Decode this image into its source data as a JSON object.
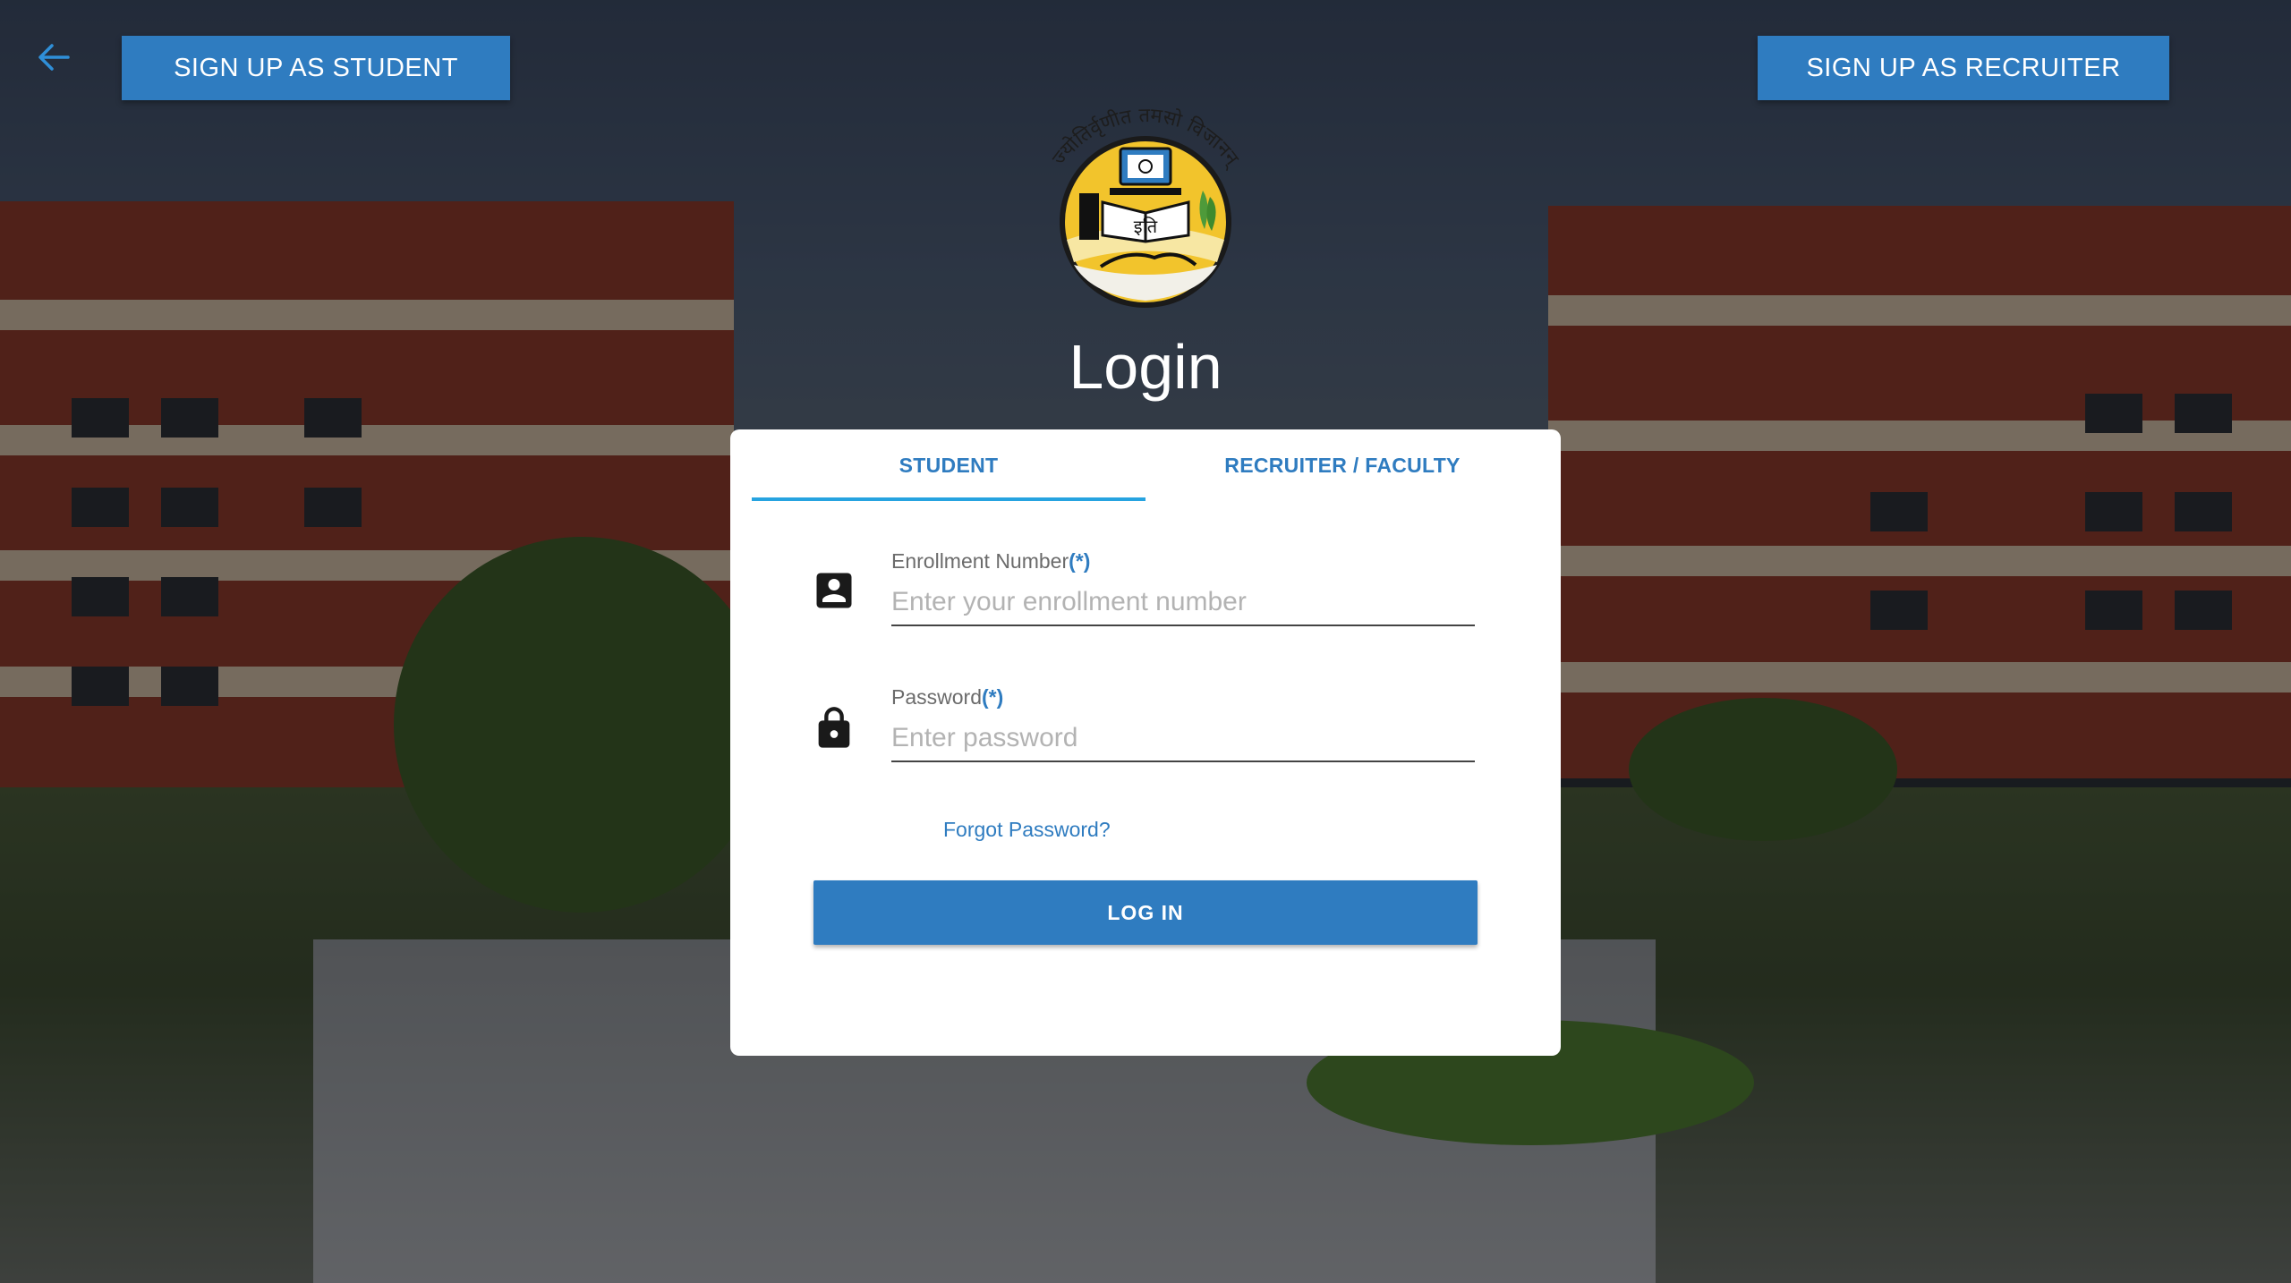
{
  "header": {
    "back_icon": "arrow-left-icon",
    "signup_student_label": "SIGN UP AS STUDENT",
    "signup_recruiter_label": "SIGN UP AS RECRUITER"
  },
  "logo": {
    "motto": "ज्योतिर्वृणीत तमसो विजानन्",
    "book_text": "इति"
  },
  "page_title": "Login",
  "tabs": [
    {
      "label": "STUDENT",
      "active": true
    },
    {
      "label": "RECRUITER / FACULTY",
      "active": false
    }
  ],
  "form": {
    "enrollment": {
      "icon": "account-box-icon",
      "label": "Enrollment Number",
      "required_mark": "(*)",
      "placeholder": "Enter your enrollment number",
      "value": ""
    },
    "password": {
      "icon": "lock-icon",
      "label": "Password",
      "required_mark": "(*)",
      "placeholder": "Enter password",
      "value": ""
    },
    "forgot_label": "Forgot Password?",
    "login_label": "LOG IN"
  },
  "colors": {
    "primary": "#2f7cc0",
    "tab_indicator": "#26a3e0",
    "card_bg": "#ffffff"
  }
}
